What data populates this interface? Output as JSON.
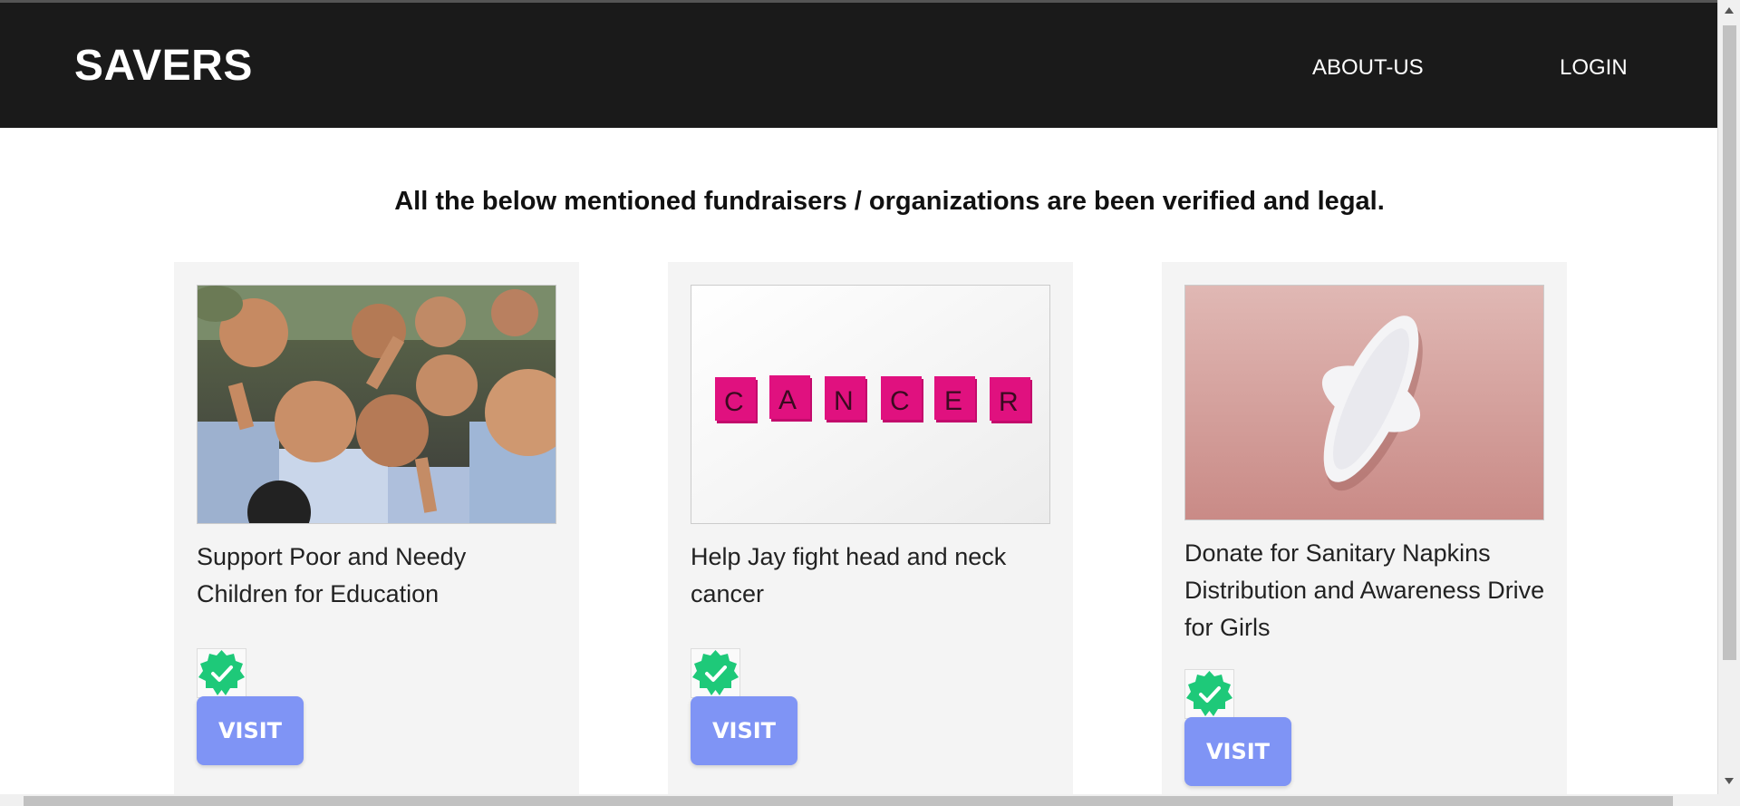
{
  "header": {
    "brand": "SAVERS",
    "nav": [
      {
        "label": "ABOUT-US"
      },
      {
        "label": "LOGIN"
      }
    ]
  },
  "notice": "All the below mentioned fundraisers / organizations are been verified and legal.",
  "cards": [
    {
      "title": "Support Poor and Needy Children for Education",
      "image": "children-photo",
      "visit_label": "VISIT",
      "badge": "verified-icon"
    },
    {
      "title": "Help Jay fight head and neck cancer",
      "image": "cancer-tiles-photo",
      "tiles": [
        "C",
        "A",
        "N",
        "C",
        "E",
        "R"
      ],
      "visit_label": "VISIT",
      "badge": "verified-icon"
    },
    {
      "title": "Donate for Sanitary Napkins Distribution and Awareness Drive for Girls",
      "image": "sanitary-napkin-photo",
      "visit_label": "VISIT",
      "badge": "verified-icon"
    }
  ],
  "colors": {
    "navbar": "#1a1a1a",
    "card": "#f4f4f4",
    "visit_button": "#7f94f5",
    "verified": "#1ec979",
    "tile": "#e0117f"
  }
}
